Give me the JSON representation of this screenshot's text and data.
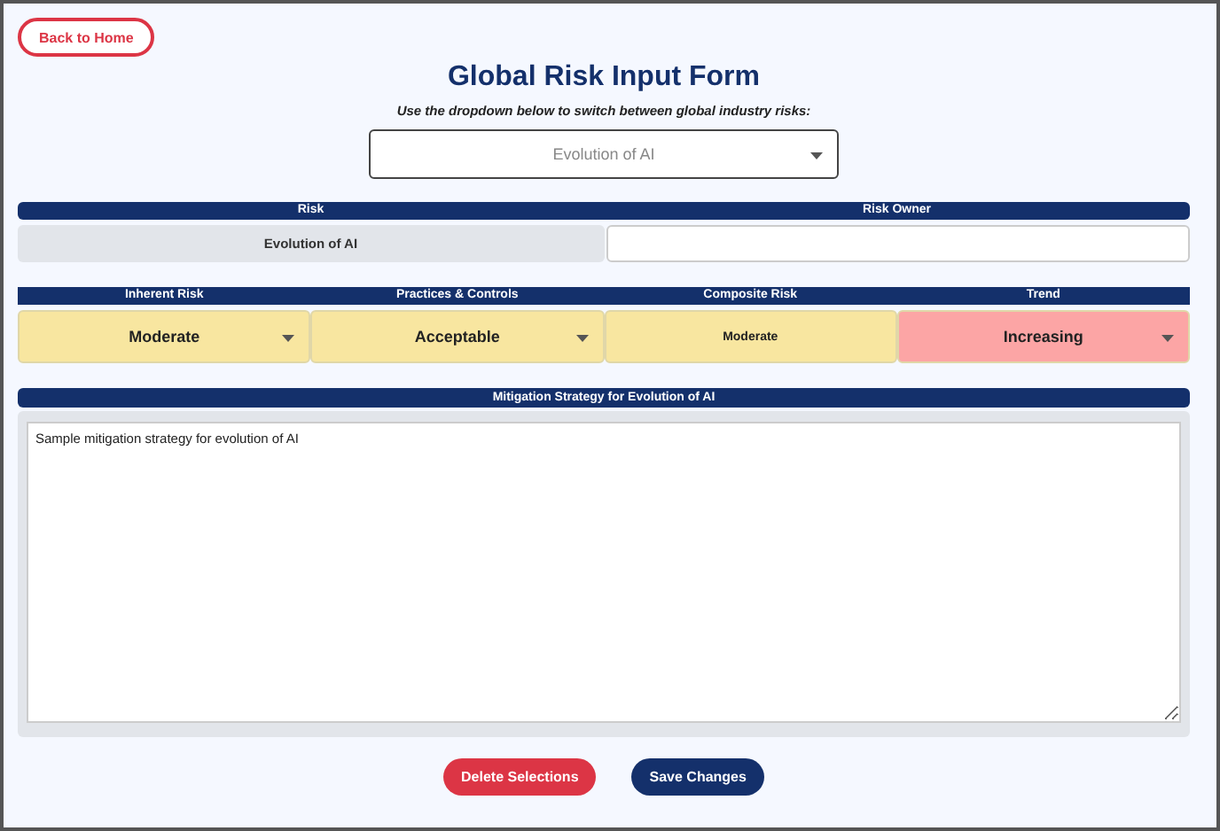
{
  "back_button": "Back to Home",
  "title": "Global Risk Input Form",
  "instruction": "Use the dropdown below to switch between global industry risks:",
  "risk_selector": {
    "value": "Evolution of AI"
  },
  "risk_table": {
    "columns": [
      "Risk",
      "Risk Owner"
    ],
    "risk": "Evolution of AI"
  },
  "assessment": [
    {
      "heading": "Inherent Risk",
      "kind": "dropdown",
      "value": "Moderate",
      "color": "#f8e6a0"
    },
    {
      "heading": "Practices & Controls",
      "kind": "dropdown",
      "value": "Acceptable",
      "color": "#f8e6a0"
    },
    {
      "heading": "Composite Risk",
      "kind": "text",
      "value": "Moderate",
      "color": "#f8e6a0"
    },
    {
      "heading": "Trend",
      "kind": "dropdown",
      "value": "Increasing",
      "color": "#fca5a5"
    }
  ],
  "mitigation": {
    "heading": "Mitigation Strategy for Evolution of AI",
    "value": "Sample mitigation strategy for evolution of AI"
  },
  "buttons": [
    {
      "label": "Delete Selections",
      "kind": "danger"
    },
    {
      "label": "Save Changes",
      "kind": "primary"
    }
  ]
}
